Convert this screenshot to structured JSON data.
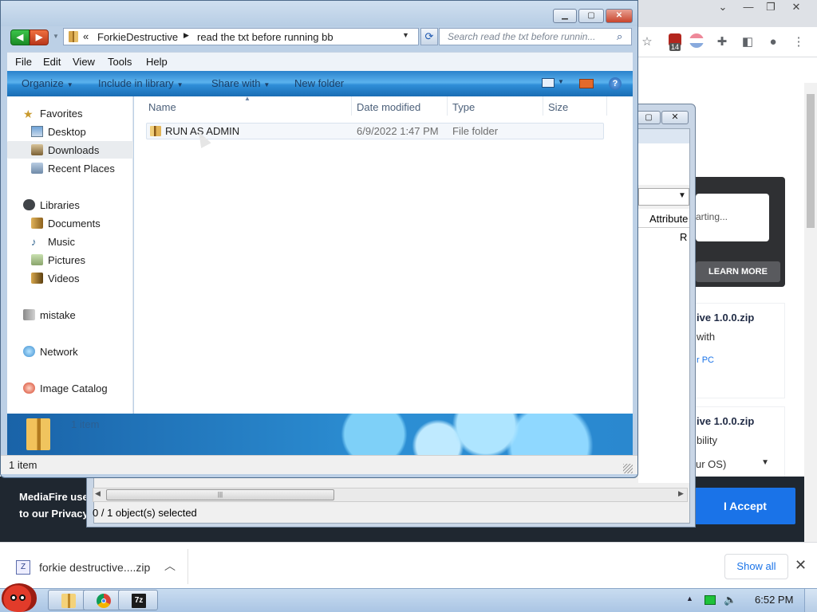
{
  "browser": {
    "page": {
      "ad_status_text": "arting...",
      "learn_more_label": "LEARN MORE",
      "file_card_1": {
        "title": "ive 1.0.0.zip",
        "subtitle": "with",
        "link": "r PC"
      },
      "file_card_2": {
        "title": "ive 1.0.0.zip",
        "subtitle": "bility",
        "select_text": "ur OS)"
      },
      "cookie_text_line1": "MediaFire use",
      "cookie_text_line2": "to our Privacy",
      "accept_label": "I Accept"
    },
    "toolbar": {
      "extension_badge_count": "14"
    },
    "download_shelf": {
      "item_name": "forkie destructive....zip",
      "show_all_label": "Show all"
    }
  },
  "background_dialog": {
    "column_header": "Attribute",
    "cell_fragment": "R",
    "status_text": "0 / 1 object(s) selected"
  },
  "explorer": {
    "address": {
      "overflow_glyph": "«",
      "crumbs": [
        "ForkieDestructive",
        "read the txt before running bb"
      ]
    },
    "search_placeholder": "Search read the txt before runnin...",
    "menu": [
      "File",
      "Edit",
      "View",
      "Tools",
      "Help"
    ],
    "commands": {
      "organize": "Organize",
      "include_in_library": "Include in library",
      "share_with": "Share with",
      "new_folder": "New folder"
    },
    "nav": {
      "favorites": "Favorites",
      "desktop": "Desktop",
      "downloads": "Downloads",
      "recent_places": "Recent Places",
      "libraries": "Libraries",
      "documents": "Documents",
      "music": "Music",
      "pictures": "Pictures",
      "videos": "Videos",
      "mistake": "mistake",
      "network": "Network",
      "image_catalog": "Image Catalog"
    },
    "columns": {
      "name": "Name",
      "date_modified": "Date modified",
      "type": "Type",
      "size": "Size"
    },
    "files": [
      {
        "name": "RUN AS ADMIN",
        "date_modified": "6/9/2022 1:47 PM",
        "type": "File folder",
        "size": ""
      }
    ],
    "details_count": "1 item",
    "status_text": "1 item"
  },
  "taskbar": {
    "clock": "6:52 PM",
    "apps": [
      "explorer",
      "chrome",
      "7-zip"
    ],
    "seven_zip_glyph": "7z"
  },
  "colors": {
    "accent_blue": "#1a73e8",
    "cookie_bar": "#1f2730",
    "command_bar": "#2f8ed8"
  }
}
